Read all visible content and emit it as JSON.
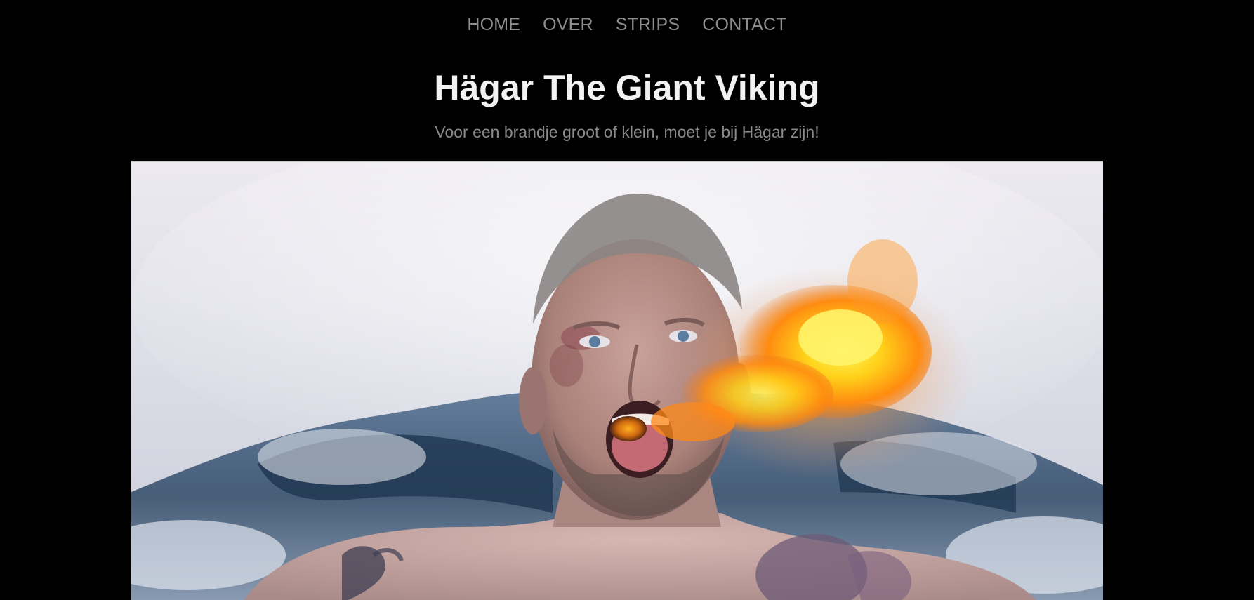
{
  "nav": {
    "items": [
      {
        "label": "HOME"
      },
      {
        "label": "OVER"
      },
      {
        "label": "STRIPS"
      },
      {
        "label": "CONTACT"
      }
    ]
  },
  "header": {
    "title": "Hägar The Giant Viking",
    "subtitle": "Voor een brandje groot of klein, moet je bij Hägar zijn!"
  },
  "colors": {
    "background": "#000000",
    "nav_text": "#8e8e8e",
    "title_text": "#f2f2f2",
    "subtitle_text": "#8a8a8a"
  }
}
